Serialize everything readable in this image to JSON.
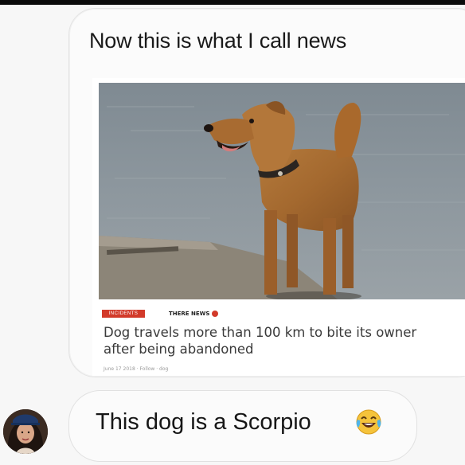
{
  "conversation": {
    "message_1": {
      "text": "Now this is what I call news"
    },
    "article": {
      "category_badge": "INCIDENTS",
      "site_name": "THERE NEWS",
      "headline_line1": "Dog travels more than 100 km to bite its owner",
      "headline_line2": "after being abandoned",
      "byline": "June 17 2018   · Follow   · dog",
      "image_subject": "dog-standing-by-water"
    },
    "message_2": {
      "text": "This dog is a Scorpio",
      "emoji": "face-with-tears-of-joy-icon"
    },
    "avatar": "user-avatar"
  },
  "colors": {
    "page_bg": "#f7f7f7",
    "bubble_bg": "#fbfbfb",
    "badge_red": "#d23a2a",
    "headline_text": "#3a3a3a"
  }
}
